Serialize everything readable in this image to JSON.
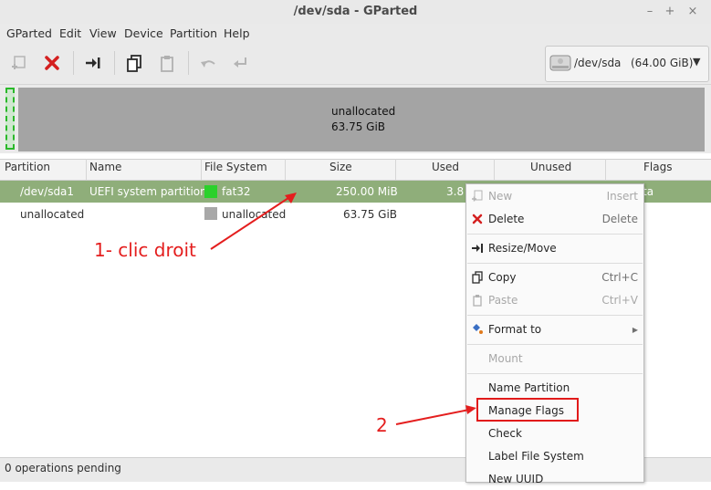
{
  "window": {
    "title": "/dev/sda - GParted"
  },
  "menubar": [
    "GParted",
    "Edit",
    "View",
    "Device",
    "Partition",
    "Help"
  ],
  "device_selector": {
    "label": "/dev/sda",
    "size": "(64.00 GiB)"
  },
  "graph": {
    "unallocated_label": "unallocated",
    "unallocated_size": "63.75 GiB"
  },
  "table": {
    "headers": [
      "Partition",
      "Name",
      "File System",
      "Size",
      "Used",
      "Unused",
      "Flags"
    ],
    "rows": [
      {
        "partition": "/dev/sda1",
        "name": "UEFI system partition",
        "fs": "fat32",
        "fs_color": "#2bd12b",
        "size": "250.00 MiB",
        "used": "3.8",
        "flags": "ta"
      },
      {
        "partition": "unallocated",
        "name": "",
        "fs": "unallocated",
        "fs_color": "#a8a8a8",
        "size": "63.75 GiB",
        "used": "",
        "flags": ""
      }
    ]
  },
  "context_menu": {
    "new": {
      "label": "New",
      "accel": "Insert"
    },
    "delete": {
      "label": "Delete",
      "accel": "Delete"
    },
    "resize": {
      "label": "Resize/Move"
    },
    "copy": {
      "label": "Copy",
      "accel": "Ctrl+C"
    },
    "paste": {
      "label": "Paste",
      "accel": "Ctrl+V"
    },
    "format": {
      "label": "Format to"
    },
    "mount": {
      "label": "Mount"
    },
    "name_partition": {
      "label": "Name Partition"
    },
    "manage_flags": {
      "label": "Manage Flags"
    },
    "check": {
      "label": "Check"
    },
    "label_fs": {
      "label": "Label File System"
    },
    "new_uuid": {
      "label": "New UUID"
    }
  },
  "annotations": {
    "step1": "1- clic droit",
    "step2": "2"
  },
  "status": {
    "text": "0 operations pending"
  },
  "colors": {
    "selected_row": "#8fae7a",
    "annotation": "#e41e1e"
  }
}
